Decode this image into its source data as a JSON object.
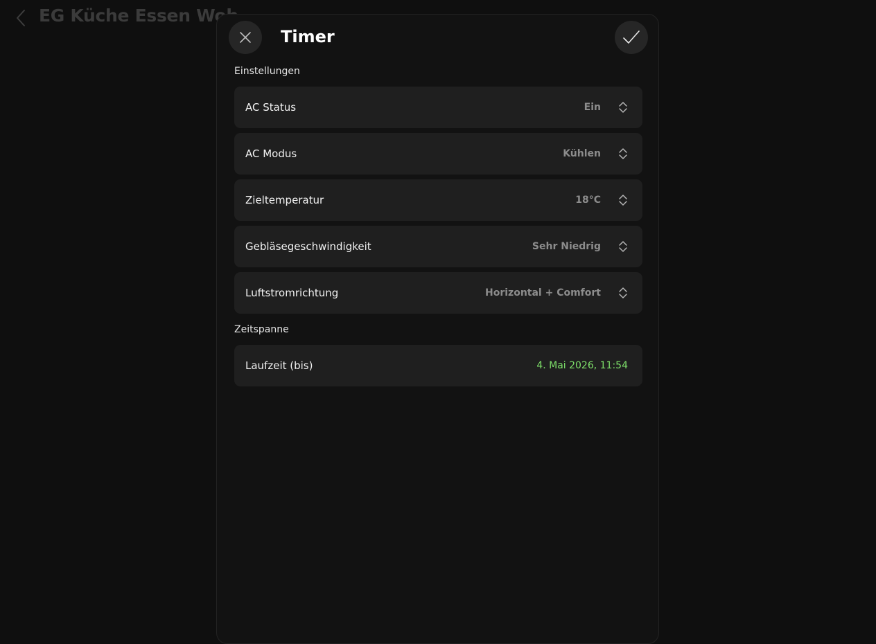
{
  "background": {
    "title": "EG Küche Essen Woh"
  },
  "sheet": {
    "title": "Timer",
    "sections": {
      "settings": "Einstellungen",
      "timespan": "Zeitspanne"
    },
    "rows": [
      {
        "label": "AC Status",
        "value": "Ein"
      },
      {
        "label": "AC Modus",
        "value": "Kühlen"
      },
      {
        "label": "Zieltemperatur",
        "value": "18°C"
      },
      {
        "label": "Gebläsegeschwindigkeit",
        "value": "Sehr Niedrig"
      },
      {
        "label": "Luftstromrichtung",
        "value": "Horizontal + Comfort"
      }
    ],
    "runtime": {
      "label": "Laufzeit (bis)",
      "value": "4. Mai 2026, 11:54"
    }
  },
  "icons": {
    "back": "chevron-left-icon",
    "close": "close-icon",
    "confirm": "checkmark-icon",
    "selector": "chevron-up-down-icon"
  },
  "colors": {
    "accent_green": "#7ee06a",
    "row_bg": "#1f1f1f",
    "sheet_bg": "#121212"
  }
}
